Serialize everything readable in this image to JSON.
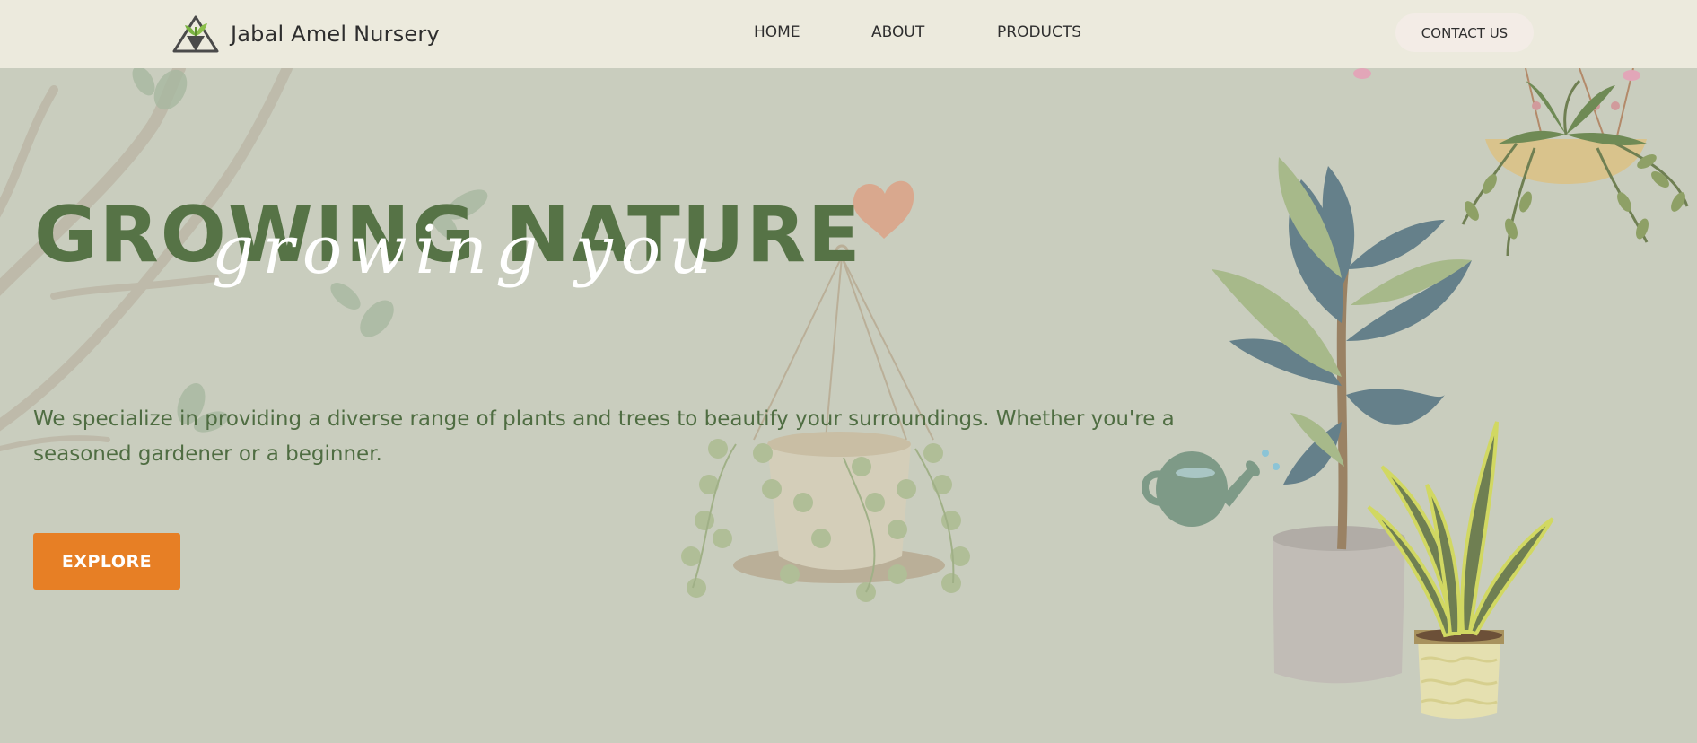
{
  "header": {
    "brand_name": "Jabal Amel Nursery",
    "logo_icon": "mountain-plant-logo",
    "nav": [
      {
        "label": "HOME"
      },
      {
        "label": "ABOUT"
      },
      {
        "label": "PRODUCTS"
      }
    ],
    "contact_label": "CONTACT US"
  },
  "hero": {
    "title": "GROWING NATURE",
    "script_title": "growing you",
    "description": "We specialize in providing a diverse range of plants and trees to beautify your surroundings. Whether you're a seasoned gardener or a beginner.",
    "cta_label": "EXPLORE"
  },
  "colors": {
    "background": "#c9cdbe",
    "header_bg": "#eceadd",
    "title_green": "#567346",
    "text_green": "#4f6d42",
    "cta_orange": "#e77f25",
    "contact_bg": "#f3ece6"
  },
  "illustrations": [
    "branch-illustration",
    "heart-icon",
    "hanging-pot-plant-illustration",
    "watering-can-icon",
    "potted-tree-illustration",
    "snake-plant-illustration",
    "hanging-basket-plant-illustration"
  ]
}
